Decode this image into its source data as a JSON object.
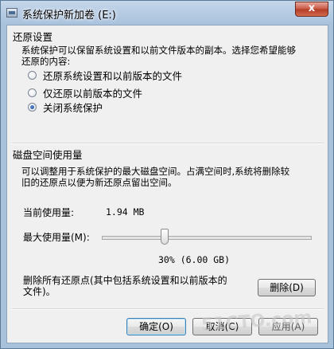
{
  "window": {
    "title": "系统保护新加卷 (E:)",
    "close_glyph": "x"
  },
  "restore_settings": {
    "title": "还原设置",
    "description_line1": "系统保护可以保留系统设置和以前文件版本的副本。选择您希望能够",
    "description_line2": "还原的内容:",
    "options": [
      {
        "label": "还原系统设置和以前版本的文件",
        "checked": false
      },
      {
        "label": "仅还原以前版本的文件",
        "checked": false
      },
      {
        "label": "关闭系统保护",
        "checked": true
      }
    ]
  },
  "disk_usage": {
    "title": "磁盘空间使用量",
    "description_line1": "可以调整用于系统保护的最大磁盘空间。占满空间时,系统将删除较",
    "description_line2": "旧的还原点以便为新还原点留出空间。",
    "current_label": "当前使用量:",
    "current_value": "1.94 MB",
    "max_label": "最大使用量(M):",
    "slider_fraction": 0.3,
    "slider_value_text": "30% (6.00 GB)"
  },
  "delete_section": {
    "text_line1": "删除所有还原点(其中包括系统设置和以前版本的",
    "text_line2": "文件)。",
    "delete_button": "删除(D)"
  },
  "buttons": {
    "ok": "确定(O)",
    "cancel": "取消(C)",
    "apply": "应用(A)"
  },
  "watermark": "51CTO.com"
}
